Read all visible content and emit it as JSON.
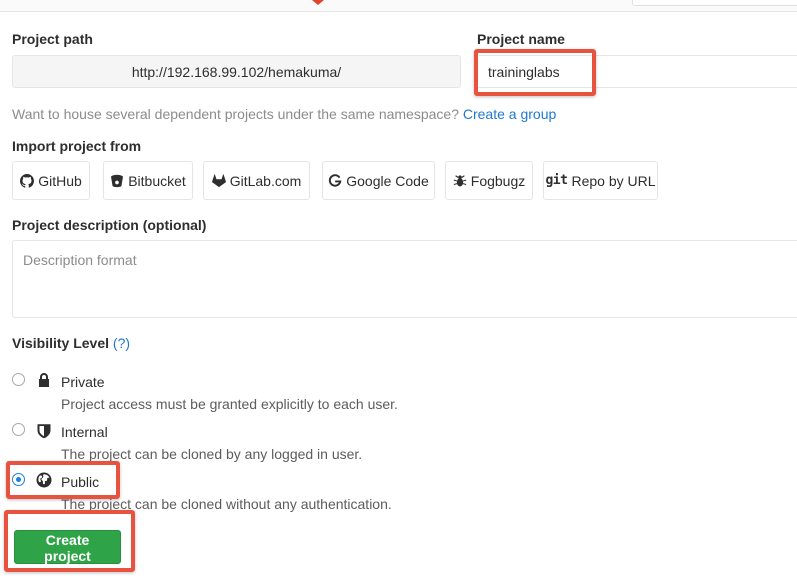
{
  "project_path": {
    "label": "Project path",
    "value": "http://192.168.99.102/hemakuma/"
  },
  "project_name": {
    "label": "Project name",
    "value": "traininglabs"
  },
  "namespace_hint": {
    "text": "Want to house several dependent projects under the same namespace?",
    "link": "Create a group"
  },
  "import": {
    "label": "Import project from",
    "sources": [
      {
        "label": "GitHub",
        "icon": "github-icon"
      },
      {
        "label": "Bitbucket",
        "icon": "bitbucket-icon"
      },
      {
        "label": "GitLab.com",
        "icon": "gitlab-icon"
      },
      {
        "label": "Google Code",
        "icon": "google-icon"
      },
      {
        "label": "Fogbugz",
        "icon": "bug-icon"
      },
      {
        "label": "Repo by URL",
        "icon": "git-icon",
        "prefix": "git"
      }
    ]
  },
  "description": {
    "label": "Project description (optional)",
    "placeholder": "Description format"
  },
  "visibility": {
    "label": "Visibility Level",
    "help": "(?)",
    "selected": "public",
    "options": [
      {
        "key": "private",
        "title": "Private",
        "icon": "lock-icon",
        "description": "Project access must be granted explicitly to each user."
      },
      {
        "key": "internal",
        "title": "Internal",
        "icon": "shield-icon",
        "description": "The project can be cloned by any logged in user."
      },
      {
        "key": "public",
        "title": "Public",
        "icon": "globe-icon",
        "description": "The project can be cloned without any authentication."
      }
    ]
  },
  "create_button": "Create project",
  "colors": {
    "accent_link": "#1f78d1",
    "create_green": "#2fa348",
    "highlight_red": "#e8533f",
    "radio_blue": "#1b7ee6"
  }
}
